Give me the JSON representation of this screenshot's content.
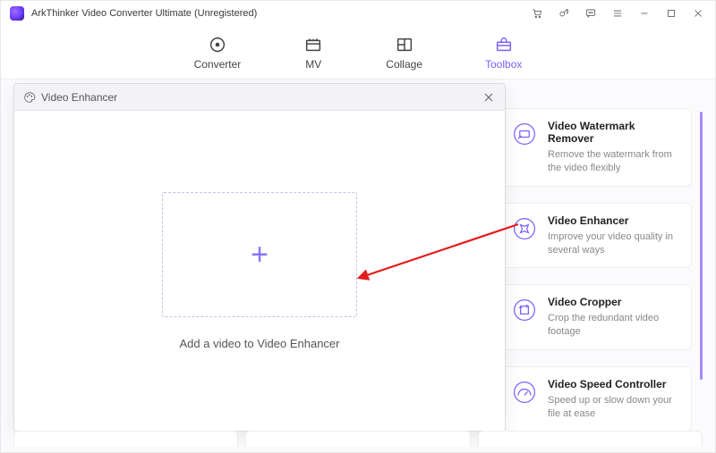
{
  "app": {
    "title": "ArkThinker Video Converter Ultimate (Unregistered)"
  },
  "tabs": {
    "converter": "Converter",
    "mv": "MV",
    "collage": "Collage",
    "toolbox": "Toolbox"
  },
  "modal": {
    "title": "Video Enhancer",
    "drop_hint": "Add a video to Video Enhancer"
  },
  "cards": [
    {
      "title": "Video Watermark Remover",
      "desc": "Remove the watermark from the video flexibly"
    },
    {
      "title": "Video Enhancer",
      "desc": "Improve your video quality in several ways"
    },
    {
      "title": "Video Cropper",
      "desc": "Crop the redundant video footage"
    },
    {
      "title": "Video Speed Controller",
      "desc": "Speed up or slow down your file at ease"
    }
  ]
}
